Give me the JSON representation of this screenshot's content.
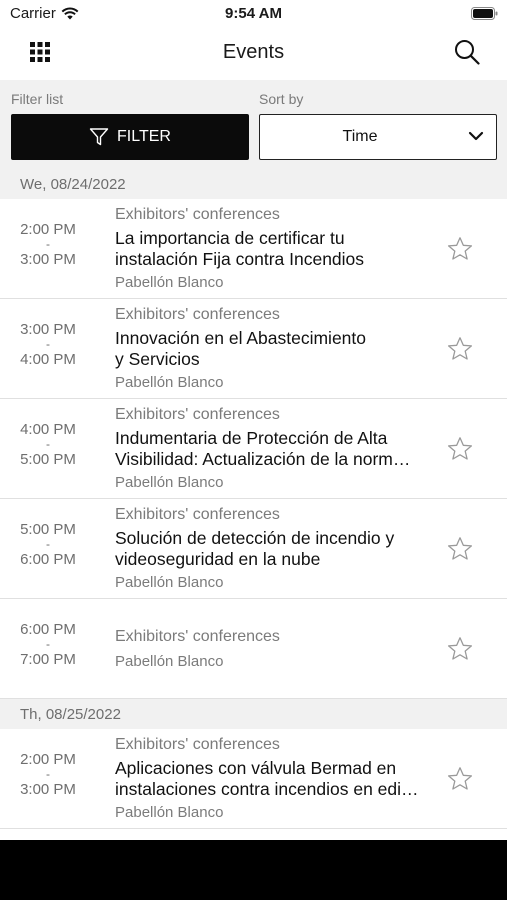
{
  "status_bar": {
    "carrier": "Carrier",
    "time": "9:54 AM"
  },
  "nav": {
    "title": "Events"
  },
  "filter_bar": {
    "filter_label": "Filter list",
    "sort_label": "Sort by",
    "filter_button": "FILTER",
    "sort_value": "Time"
  },
  "days": [
    {
      "date": "We, 08/24/2022",
      "events": [
        {
          "start": "2:00 PM",
          "sep": "-",
          "end": "3:00 PM",
          "category": "Exhibitors' conferences",
          "title_lines": [
            "La importancia de certificar tu",
            "instalación Fija contra Incendios"
          ],
          "location": "Pabellón Blanco"
        },
        {
          "start": "3:00 PM",
          "sep": "-",
          "end": "4:00 PM",
          "category": "Exhibitors' conferences",
          "title_lines": [
            "Innovación en el Abastecimiento",
            "y Servicios"
          ],
          "location": "Pabellón Blanco"
        },
        {
          "start": "4:00 PM",
          "sep": "-",
          "end": "5:00 PM",
          "category": "Exhibitors' conferences",
          "title_lines": [
            "Indumentaria de Protección de Alta",
            "Visibilidad: Actualización de la norm…"
          ],
          "location": "Pabellón Blanco"
        },
        {
          "start": "5:00 PM",
          "sep": "-",
          "end": "6:00 PM",
          "category": "Exhibitors' conferences",
          "title_lines": [
            "Solución de detección de incendio y",
            "videoseguridad en la nube"
          ],
          "location": "Pabellón Blanco"
        },
        {
          "start": "6:00 PM",
          "sep": "-",
          "end": "7:00 PM",
          "category": "Exhibitors' conferences",
          "title_lines": [],
          "location": "Pabellón Blanco"
        }
      ]
    },
    {
      "date": "Th, 08/25/2022",
      "events": [
        {
          "start": "2:00 PM",
          "sep": "-",
          "end": "3:00 PM",
          "category": "Exhibitors' conferences",
          "title_lines": [
            "Aplicaciones con válvula Bermad en",
            "instalaciones contra incendios en edi…"
          ],
          "location": "Pabellón Blanco"
        }
      ]
    }
  ]
}
